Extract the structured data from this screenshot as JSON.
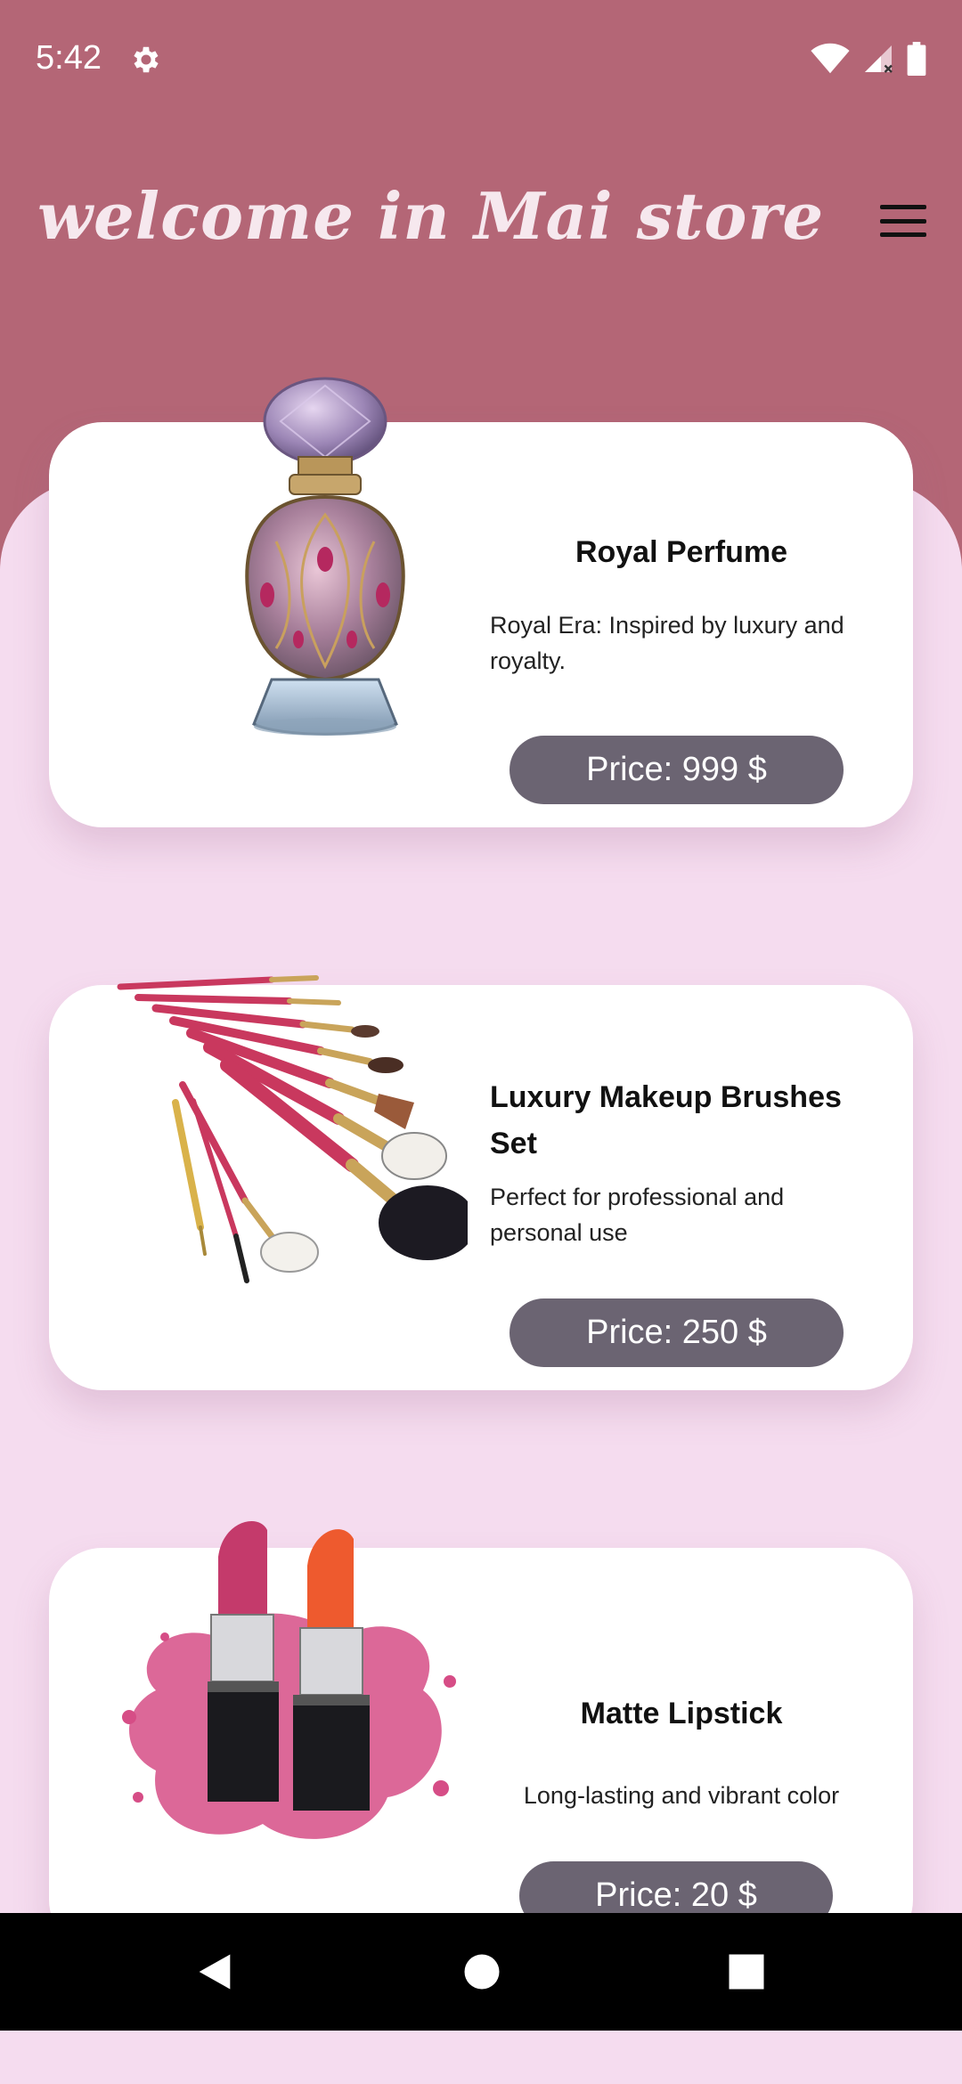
{
  "status_bar": {
    "time": "5:42"
  },
  "header": {
    "title": "welcome in Mai store"
  },
  "products": [
    {
      "name": "Royal Perfume",
      "description": "Royal Era: Inspired by luxury and royalty.",
      "price": "Price: 999 $",
      "image": "perfume-bottle-image"
    },
    {
      "name": "Luxury Makeup Brushes Set",
      "description": "Perfect for professional and personal use",
      "price": "Price: 250 $",
      "image": "makeup-brushes-image"
    },
    {
      "name": "Matte Lipstick",
      "description": "Long-lasting and vibrant color",
      "price": "Price: 20 $",
      "image": "lipstick-image"
    }
  ],
  "colors": {
    "header": "#b46676",
    "background": "#f5dcef",
    "price_button": "#6b6472",
    "card": "#ffffff"
  },
  "icons": {
    "settings": "gear-icon",
    "wifi": "wifi-icon",
    "signal": "signal-icon",
    "battery": "battery-icon",
    "menu": "hamburger-menu-icon",
    "back": "back-triangle-icon",
    "home": "home-circle-icon",
    "recents": "recents-square-icon"
  }
}
